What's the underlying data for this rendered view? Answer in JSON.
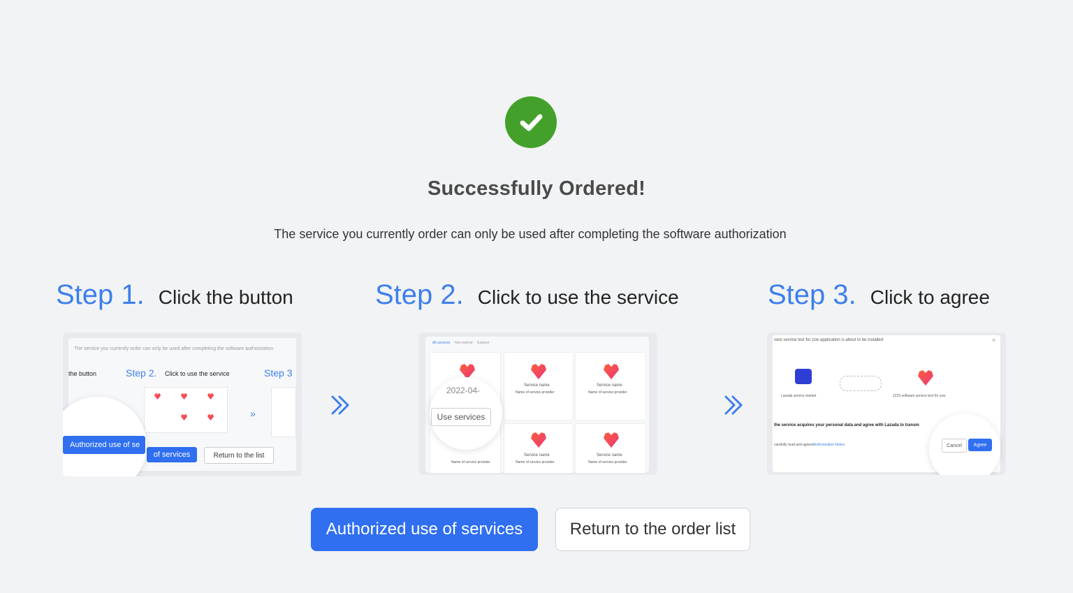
{
  "header": {
    "title": "Successfully Ordered!",
    "subtitle": "The service you currently order can only be used after completing the software authorization"
  },
  "steps": [
    {
      "label": "Step 1.",
      "description": "Click the button"
    },
    {
      "label": "Step 2.",
      "description": "Click to use the service"
    },
    {
      "label": "Step 3.",
      "description": "Click to agree"
    }
  ],
  "thumbnails": {
    "step1": {
      "notice": "The service you currently order can only be used after completing the software authorization",
      "mini_step_prefix": "the button",
      "mini_step2_label": "Step 2.",
      "mini_step2_desc": "Click to use the service",
      "mini_step3_label": "Step 3",
      "authorize_label": "Authorized use of se",
      "authorize_rest": "of services",
      "return_label": "Return to the list"
    },
    "step2": {
      "tabs": [
        "All services",
        "Not expired",
        "Expired"
      ],
      "date": "2022-04-",
      "use_services": "Use services",
      "service_name": "Service name",
      "provider": "Name of service provider"
    },
    "step3": {
      "header": "vare service test for zzw application is about to be installed",
      "market_label": "Lazada service market",
      "app_label": "1215 software service test for zzw",
      "consent": "the service acquires your personal data and agree with Lazada to transm",
      "notice": "carefully read and agreed",
      "notice_link": "Authorization Notice",
      "cancel": "Cancel",
      "agree": "Agree"
    }
  },
  "actions": {
    "authorize": "Authorized use of services",
    "return": "Return to the order list"
  },
  "colors": {
    "success": "#43a12b",
    "accent": "#3d7fec",
    "primary_button": "#2f6ff0"
  },
  "icons": [
    "check-icon",
    "double-chevron-right-icon"
  ]
}
